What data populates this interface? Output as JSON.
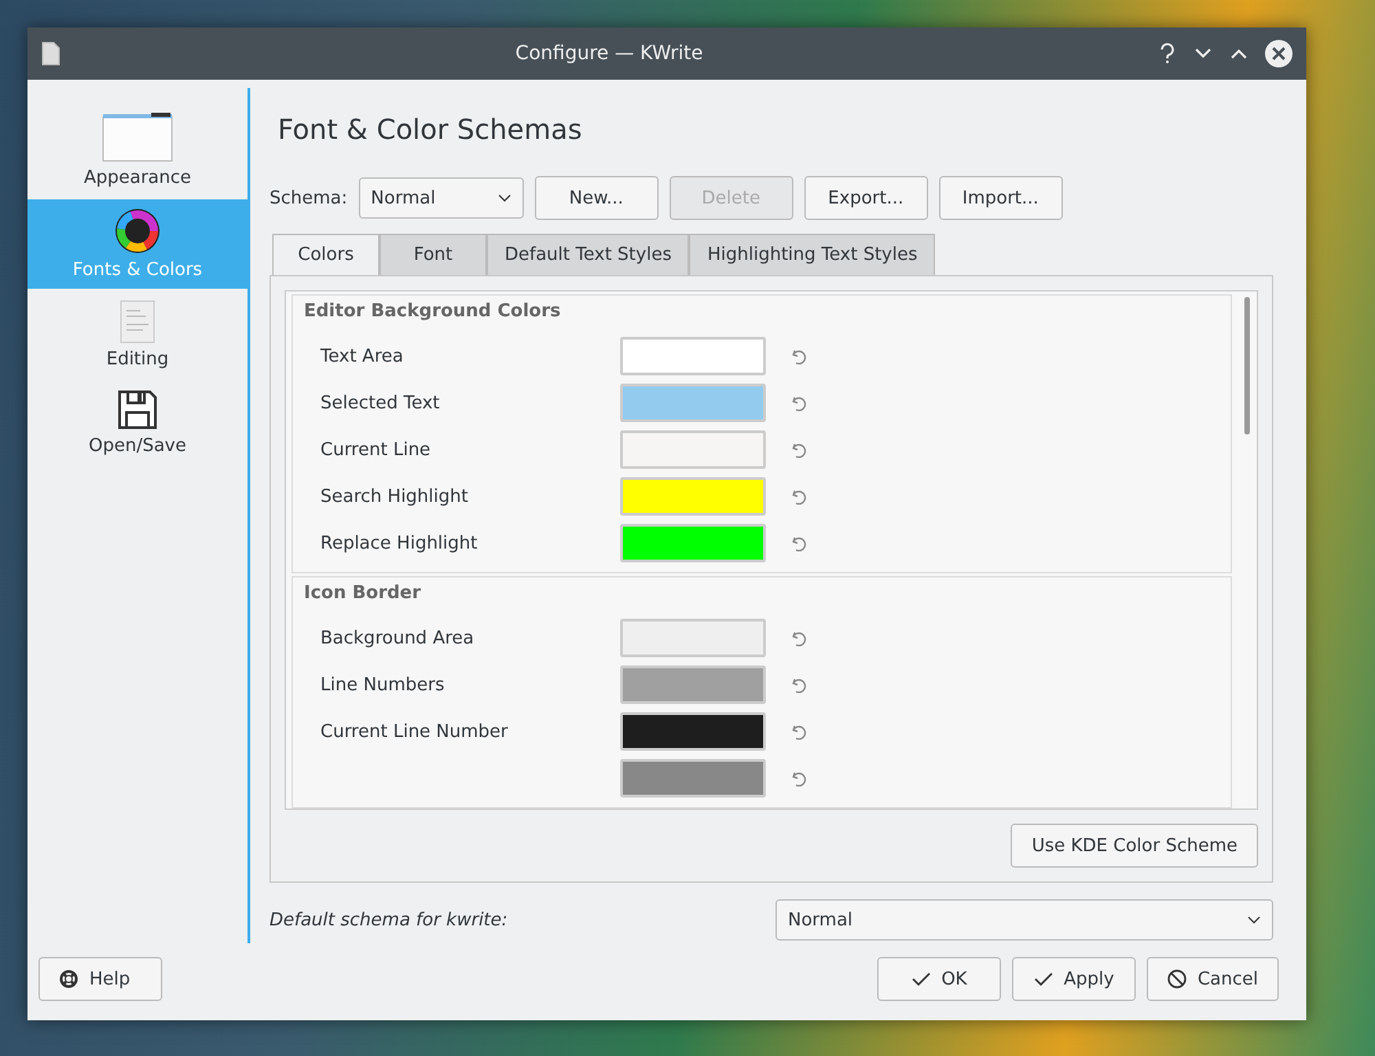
{
  "window": {
    "title": "Configure — KWrite"
  },
  "sidebar": {
    "items": [
      {
        "label": "Appearance",
        "kind": "window",
        "selected": false
      },
      {
        "label": "Fonts & Colors",
        "kind": "color-wheel",
        "selected": true
      },
      {
        "label": "Editing",
        "kind": "document",
        "selected": false
      },
      {
        "label": "Open/Save",
        "kind": "floppy",
        "selected": false
      }
    ]
  },
  "page_title": "Font & Color Schemas",
  "schema": {
    "label": "Schema:",
    "value": "Normal"
  },
  "schema_buttons": [
    {
      "label": "New...",
      "disabled": false
    },
    {
      "label": "Delete",
      "disabled": true
    },
    {
      "label": "Export...",
      "disabled": false
    },
    {
      "label": "Import...",
      "disabled": false
    }
  ],
  "tabs": [
    {
      "label": "Colors",
      "selected": true
    },
    {
      "label": "Font",
      "selected": false
    },
    {
      "label": "Default Text Styles",
      "selected": false
    },
    {
      "label": "Highlighting Text Styles",
      "selected": false
    }
  ],
  "groups": [
    {
      "title": "Editor Background Colors",
      "rows": [
        {
          "label": "Text Area",
          "color": "#ffffff"
        },
        {
          "label": "Selected Text",
          "color": "#93cbef"
        },
        {
          "label": "Current Line",
          "color": "#f6f5f4"
        },
        {
          "label": "Search Highlight",
          "color": "#ffff00"
        },
        {
          "label": "Replace Highlight",
          "color": "#00ff00"
        }
      ]
    },
    {
      "title": "Icon Border",
      "rows": [
        {
          "label": "Background Area",
          "color": "#efefef"
        },
        {
          "label": "Line Numbers",
          "color": "#a0a0a0"
        },
        {
          "label": "Current Line Number",
          "color": "#1e1e1e"
        },
        {
          "color": "#888888"
        }
      ]
    }
  ],
  "use_kde_button": "Use KDE Color Scheme",
  "default_schema": {
    "label": "Default schema for kwrite:",
    "value": "Normal"
  },
  "help_button": "Help",
  "dialog_buttons": [
    {
      "label": "OK",
      "kind": "confirm"
    },
    {
      "label": "Apply",
      "kind": "confirm"
    },
    {
      "label": "Cancel",
      "kind": "cancel"
    }
  ]
}
